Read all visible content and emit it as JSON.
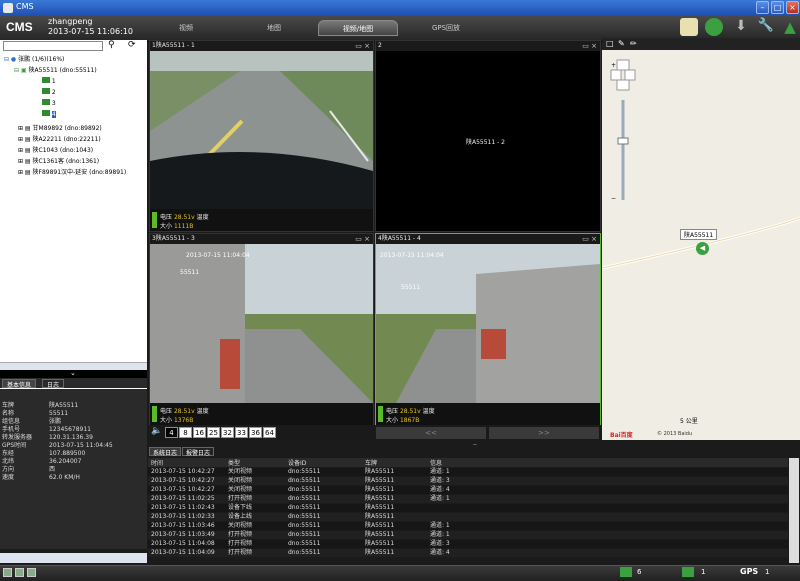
{
  "window": {
    "title": "CMS"
  },
  "header": {
    "logo": "CMS",
    "user": "zhangpeng",
    "datetime": "2013-07-15 11:06:10",
    "tabs": [
      "视频",
      "地图",
      "视频/地图",
      "GPS回放"
    ],
    "active_tab": 2
  },
  "tree": {
    "root": "张鹏  (1/6)(16%)",
    "device": "陕A55511  (dno:55511)",
    "channels": [
      "1",
      "2",
      "3",
      "4"
    ],
    "others": [
      "甘M89892  (dno:89892)",
      "陕A22211  (dno:22211)",
      "陕C1043  (dno:1043)",
      "陕C1361客  (dno:1361)",
      "陕F89891汉中-延安  (dno:89891)"
    ]
  },
  "info": {
    "tabs": [
      "基本信息",
      "日志"
    ],
    "rows": [
      {
        "k": "车牌",
        "v": "陕A55511"
      },
      {
        "k": "名称",
        "v": "55511"
      },
      {
        "k": "组信息",
        "v": "张鹏"
      },
      {
        "k": "手机号",
        "v": "12345678911"
      },
      {
        "k": "转发服务器",
        "v": "120.31.136.39"
      },
      {
        "k": "GPS时间",
        "v": "2013-07-15 11:04:45"
      },
      {
        "k": "东经",
        "v": "107.889500"
      },
      {
        "k": "北纬",
        "v": "36.204007"
      },
      {
        "k": "方向",
        "v": "西"
      },
      {
        "k": "速度",
        "v": "62.0 KM/H"
      }
    ]
  },
  "panes": [
    {
      "title": "1陕A55511 - 1",
      "volt_label": "电压",
      "volt": "28.51v",
      "temp_label": "温度",
      "size_label": "大小",
      "size": "1111B",
      "overlay": ""
    },
    {
      "title": "2",
      "center": "陕A55511 - 2"
    },
    {
      "title": "3陕A55511 - 3",
      "volt_label": "电压",
      "volt": "28.51v",
      "temp_label": "温度",
      "size_label": "大小",
      "size": "1376B",
      "overlay": "2013-07-15  11:04:04"
    },
    {
      "title": "4陕A55511 - 4",
      "volt_label": "电压",
      "volt": "28.51v",
      "temp_label": "温度",
      "size_label": "大小",
      "size": "1867B",
      "overlay": "2013-07-15  11:04:04"
    }
  ],
  "split_buttons": [
    "4",
    "8",
    "16",
    "25",
    "32",
    "33",
    "36",
    "64"
  ],
  "pager": {
    "prev": "<<",
    "next": ">>"
  },
  "map": {
    "marker_label": "陕A55511",
    "scale": "5 公里",
    "copyright": "© 2013 Baidu",
    "brand": "Bai百度"
  },
  "log": {
    "tabs": [
      "系统日志",
      "报警日志"
    ],
    "headers": [
      "时间",
      "类型",
      "设备ID",
      "车牌",
      "信息"
    ],
    "rows": [
      [
        "2013-07-15 10:42:27",
        "关闭视频",
        "dno:55511",
        "陕A55511",
        "通道: 1"
      ],
      [
        "2013-07-15 10:42:27",
        "关闭视频",
        "dno:55511",
        "陕A55511",
        "通道: 3"
      ],
      [
        "2013-07-15 10:42:27",
        "关闭视频",
        "dno:55511",
        "陕A55511",
        "通道: 4"
      ],
      [
        "2013-07-15 11:02:25",
        "打开视频",
        "dno:55511",
        "陕A55511",
        "通道: 1"
      ],
      [
        "2013-07-15 11:02:43",
        "设备下线",
        "dno:55511",
        "陕A55511",
        ""
      ],
      [
        "2013-07-15 11:02:33",
        "设备上线",
        "dno:55511",
        "陕A55511",
        ""
      ],
      [
        "2013-07-15 11:03:46",
        "关闭视频",
        "dno:55511",
        "陕A55511",
        "通道: 1"
      ],
      [
        "2013-07-15 11:03:49",
        "打开视频",
        "dno:55511",
        "陕A55511",
        "通道: 1"
      ],
      [
        "2013-07-15 11:04:08",
        "打开视频",
        "dno:55511",
        "陕A55511",
        "通道: 3"
      ],
      [
        "2013-07-15 11:04:09",
        "打开视频",
        "dno:55511",
        "陕A55511",
        "通道: 4"
      ]
    ]
  },
  "status": {
    "online": "6",
    "count": "1",
    "gps": "GPS",
    "gps_count": "1"
  },
  "colors": {
    "accent": "#5dbb2b",
    "title": "#2b5cc2",
    "warn": "#e7c21a"
  }
}
